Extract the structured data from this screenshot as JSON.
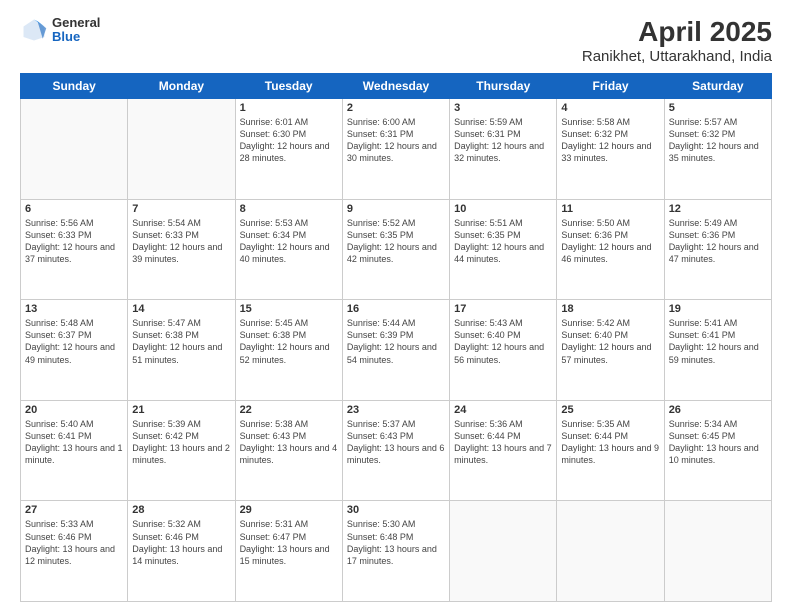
{
  "logo": {
    "general": "General",
    "blue": "Blue"
  },
  "title": "April 2025",
  "subtitle": "Ranikhet, Uttarakhand, India",
  "days_header": [
    "Sunday",
    "Monday",
    "Tuesday",
    "Wednesday",
    "Thursday",
    "Friday",
    "Saturday"
  ],
  "weeks": [
    [
      {
        "day": "",
        "sunrise": "",
        "sunset": "",
        "daylight": ""
      },
      {
        "day": "",
        "sunrise": "",
        "sunset": "",
        "daylight": ""
      },
      {
        "day": "1",
        "sunrise": "Sunrise: 6:01 AM",
        "sunset": "Sunset: 6:30 PM",
        "daylight": "Daylight: 12 hours and 28 minutes."
      },
      {
        "day": "2",
        "sunrise": "Sunrise: 6:00 AM",
        "sunset": "Sunset: 6:31 PM",
        "daylight": "Daylight: 12 hours and 30 minutes."
      },
      {
        "day": "3",
        "sunrise": "Sunrise: 5:59 AM",
        "sunset": "Sunset: 6:31 PM",
        "daylight": "Daylight: 12 hours and 32 minutes."
      },
      {
        "day": "4",
        "sunrise": "Sunrise: 5:58 AM",
        "sunset": "Sunset: 6:32 PM",
        "daylight": "Daylight: 12 hours and 33 minutes."
      },
      {
        "day": "5",
        "sunrise": "Sunrise: 5:57 AM",
        "sunset": "Sunset: 6:32 PM",
        "daylight": "Daylight: 12 hours and 35 minutes."
      }
    ],
    [
      {
        "day": "6",
        "sunrise": "Sunrise: 5:56 AM",
        "sunset": "Sunset: 6:33 PM",
        "daylight": "Daylight: 12 hours and 37 minutes."
      },
      {
        "day": "7",
        "sunrise": "Sunrise: 5:54 AM",
        "sunset": "Sunset: 6:33 PM",
        "daylight": "Daylight: 12 hours and 39 minutes."
      },
      {
        "day": "8",
        "sunrise": "Sunrise: 5:53 AM",
        "sunset": "Sunset: 6:34 PM",
        "daylight": "Daylight: 12 hours and 40 minutes."
      },
      {
        "day": "9",
        "sunrise": "Sunrise: 5:52 AM",
        "sunset": "Sunset: 6:35 PM",
        "daylight": "Daylight: 12 hours and 42 minutes."
      },
      {
        "day": "10",
        "sunrise": "Sunrise: 5:51 AM",
        "sunset": "Sunset: 6:35 PM",
        "daylight": "Daylight: 12 hours and 44 minutes."
      },
      {
        "day": "11",
        "sunrise": "Sunrise: 5:50 AM",
        "sunset": "Sunset: 6:36 PM",
        "daylight": "Daylight: 12 hours and 46 minutes."
      },
      {
        "day": "12",
        "sunrise": "Sunrise: 5:49 AM",
        "sunset": "Sunset: 6:36 PM",
        "daylight": "Daylight: 12 hours and 47 minutes."
      }
    ],
    [
      {
        "day": "13",
        "sunrise": "Sunrise: 5:48 AM",
        "sunset": "Sunset: 6:37 PM",
        "daylight": "Daylight: 12 hours and 49 minutes."
      },
      {
        "day": "14",
        "sunrise": "Sunrise: 5:47 AM",
        "sunset": "Sunset: 6:38 PM",
        "daylight": "Daylight: 12 hours and 51 minutes."
      },
      {
        "day": "15",
        "sunrise": "Sunrise: 5:45 AM",
        "sunset": "Sunset: 6:38 PM",
        "daylight": "Daylight: 12 hours and 52 minutes."
      },
      {
        "day": "16",
        "sunrise": "Sunrise: 5:44 AM",
        "sunset": "Sunset: 6:39 PM",
        "daylight": "Daylight: 12 hours and 54 minutes."
      },
      {
        "day": "17",
        "sunrise": "Sunrise: 5:43 AM",
        "sunset": "Sunset: 6:40 PM",
        "daylight": "Daylight: 12 hours and 56 minutes."
      },
      {
        "day": "18",
        "sunrise": "Sunrise: 5:42 AM",
        "sunset": "Sunset: 6:40 PM",
        "daylight": "Daylight: 12 hours and 57 minutes."
      },
      {
        "day": "19",
        "sunrise": "Sunrise: 5:41 AM",
        "sunset": "Sunset: 6:41 PM",
        "daylight": "Daylight: 12 hours and 59 minutes."
      }
    ],
    [
      {
        "day": "20",
        "sunrise": "Sunrise: 5:40 AM",
        "sunset": "Sunset: 6:41 PM",
        "daylight": "Daylight: 13 hours and 1 minute."
      },
      {
        "day": "21",
        "sunrise": "Sunrise: 5:39 AM",
        "sunset": "Sunset: 6:42 PM",
        "daylight": "Daylight: 13 hours and 2 minutes."
      },
      {
        "day": "22",
        "sunrise": "Sunrise: 5:38 AM",
        "sunset": "Sunset: 6:43 PM",
        "daylight": "Daylight: 13 hours and 4 minutes."
      },
      {
        "day": "23",
        "sunrise": "Sunrise: 5:37 AM",
        "sunset": "Sunset: 6:43 PM",
        "daylight": "Daylight: 13 hours and 6 minutes."
      },
      {
        "day": "24",
        "sunrise": "Sunrise: 5:36 AM",
        "sunset": "Sunset: 6:44 PM",
        "daylight": "Daylight: 13 hours and 7 minutes."
      },
      {
        "day": "25",
        "sunrise": "Sunrise: 5:35 AM",
        "sunset": "Sunset: 6:44 PM",
        "daylight": "Daylight: 13 hours and 9 minutes."
      },
      {
        "day": "26",
        "sunrise": "Sunrise: 5:34 AM",
        "sunset": "Sunset: 6:45 PM",
        "daylight": "Daylight: 13 hours and 10 minutes."
      }
    ],
    [
      {
        "day": "27",
        "sunrise": "Sunrise: 5:33 AM",
        "sunset": "Sunset: 6:46 PM",
        "daylight": "Daylight: 13 hours and 12 minutes."
      },
      {
        "day": "28",
        "sunrise": "Sunrise: 5:32 AM",
        "sunset": "Sunset: 6:46 PM",
        "daylight": "Daylight: 13 hours and 14 minutes."
      },
      {
        "day": "29",
        "sunrise": "Sunrise: 5:31 AM",
        "sunset": "Sunset: 6:47 PM",
        "daylight": "Daylight: 13 hours and 15 minutes."
      },
      {
        "day": "30",
        "sunrise": "Sunrise: 5:30 AM",
        "sunset": "Sunset: 6:48 PM",
        "daylight": "Daylight: 13 hours and 17 minutes."
      },
      {
        "day": "",
        "sunrise": "",
        "sunset": "",
        "daylight": ""
      },
      {
        "day": "",
        "sunrise": "",
        "sunset": "",
        "daylight": ""
      },
      {
        "day": "",
        "sunrise": "",
        "sunset": "",
        "daylight": ""
      }
    ]
  ]
}
